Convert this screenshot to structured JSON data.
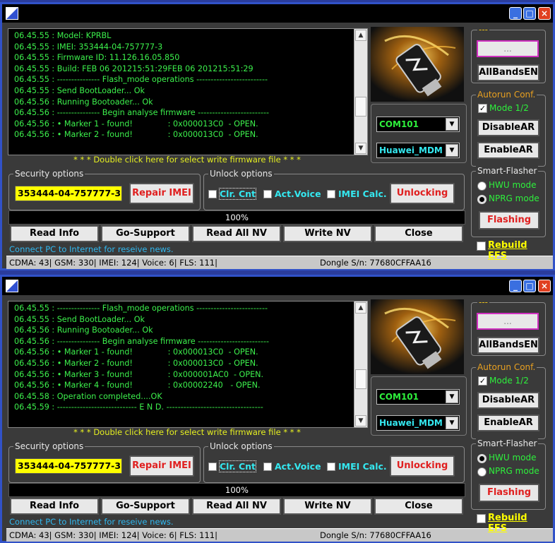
{
  "windows": [
    {
      "title_buttons": {
        "minimize": "_",
        "maximize": "□",
        "close": "×"
      },
      "log_lines": [
        "06.45.55 : Model: KPRBL",
        "06.45.55 : IMEI: 353444-04-757777-3",
        "06.45.55 : Firmware ID: 11.126.16.05.850",
        "06.45.55 : Build: FEB 06 201215:51:29FEB 06 201215:51:29",
        "06.45.55 : --------------- Flash_mode operations -------------------------",
        "06.45.55 : Send BootLoader... Ok",
        "06.45.56 : Running Bootoader... Ok",
        "06.45.56 : --------------- Begin analyse firmware -------------------------",
        "06.45.56 : • Marker 1 - found!              : 0x000013C0  - OPEN.",
        "06.45.56 : • Marker 2 - found!              : 0x000013C0  - OPEN."
      ],
      "scroll_thumb": "bottom",
      "security_options_label": "Security options",
      "imei_value": "353444-04-757777-3",
      "repair_imei": "Repair IMEI",
      "unlock_options_label": "Unlock options",
      "chk_clr_cnt": "Clr. Cnt",
      "chk_act_voice": "Act.Voice",
      "chk_imei_calc": "IMEI Calc.",
      "unlocking": "Unlocking",
      "progress_text": "100%",
      "mode_label": "Mode 1/2",
      "hwu_mode": "HWU mode",
      "nprg_mode": "NPRG mode",
      "selected_mode": "nprg"
    },
    {
      "title_buttons": {
        "minimize": "_",
        "maximize": "□",
        "close": "×"
      },
      "log_lines": [
        "06.45.55 : --------------- Flash_mode operations -------------------------",
        "06.45.55 : Send BootLoader... Ok",
        "06.45.56 : Running Bootoader... Ok",
        "06.45.56 : --------------- Begin analyse firmware -------------------------",
        "06.45.56 : • Marker 1 - found!              : 0x000013C0  - OPEN.",
        "06.45.56 : • Marker 2 - found!              : 0x000013C0  - OPEN.",
        "06.45.56 : • Marker 3 - found!              : 0x000001AC0  - OPEN.",
        "06.45.56 : • Marker 4 - found!              : 0x00002240   - OPEN.",
        "06.45.58 : Operation completed....OK",
        "06.45.59 : ---------------------------- E N D. ----------------------------------"
      ],
      "scroll_thumb": "bottom",
      "security_options_label": "Security options",
      "imei_value": "353444-04-757777-3",
      "repair_imei": "Repair IMEI",
      "unlock_options_label": "Unlock options",
      "chk_clr_cnt": "Clr. Cnt",
      "chk_act_voice": "Act.Voice",
      "chk_imei_calc": "IMEI Calc.",
      "unlocking": "Unlocking",
      "progress_text": "100%",
      "mode_label": "Mode 1/2",
      "hwu_mode": "HWU mode",
      "nprg_mode": "NPRG mode",
      "selected_mode": "hwu"
    }
  ],
  "common": {
    "dblclick_hint": "* * * Double click here for select write firmware file * * *",
    "port": "COM101",
    "model": "Huawei_MDM",
    "buttons": [
      "Read Info",
      "Go-Support",
      "Read All NV",
      "Write NV",
      "Close"
    ],
    "news": "Connect PC to Internet for reseive news.",
    "status_left": "CDMA: 43| GSM: 330| IMEI: 124| Voice: 6| FLS: 111|",
    "status_right": "Dongle S/n: 77680CFFAA16",
    "group1_label": "---",
    "pink_input": "...",
    "allbands": "AllBandsEN",
    "autorun_label": "Autorun Conf.",
    "disable_ar": "DisableAR",
    "enable_ar": "EnableAR",
    "smartflasher_label": "Smart-Flasher",
    "flashing": "Flashing",
    "rebuild_efs": "Rebuild EFS",
    "check_mark": "✓",
    "arrow_up": "▲",
    "arrow_down": "▼",
    "combo_arrow": "▼"
  }
}
